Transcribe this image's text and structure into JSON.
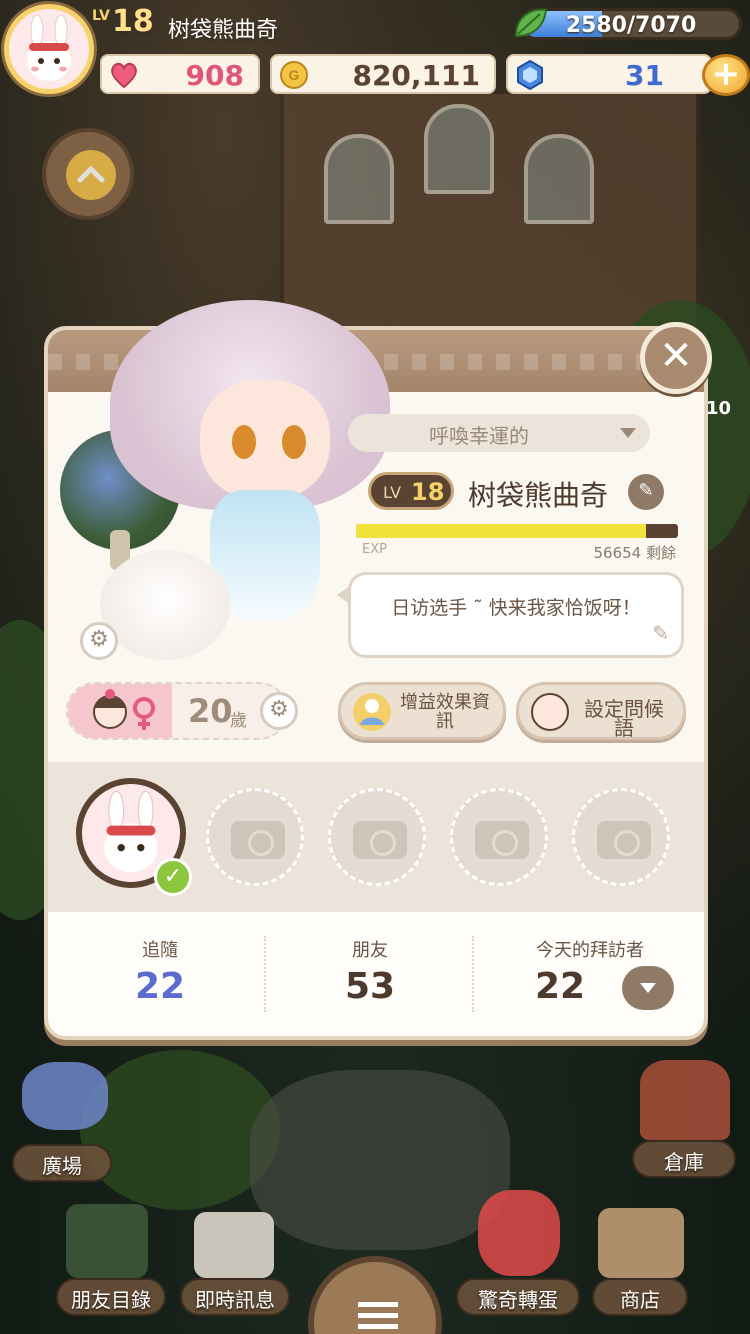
{
  "hud": {
    "level_label": "LV",
    "level": "18",
    "player_name": "树袋熊曲奇",
    "energy_text": "2580/7070",
    "energy_fraction": 0.365,
    "hearts": "908",
    "gold": "820,111",
    "gems": "31",
    "plus": "+"
  },
  "profile": {
    "close": "✕",
    "title_dropdown": "呼喚幸運的",
    "level_label": "LV",
    "level": "18",
    "name": "树袋熊曲奇",
    "exp_label": "EXP",
    "exp_remaining": "56654 剩餘",
    "exp_fraction": 0.9,
    "greeting": "日访选手 ˜ 快来我家恰饭呀！",
    "age_number": "20",
    "age_unit": "歲",
    "buff_button": "增益效果資訊",
    "greeting_button": "設定問候語",
    "stats": [
      {
        "label": "追隨",
        "value": "22",
        "color": "#5b6bd0"
      },
      {
        "label": "朋友",
        "value": "53",
        "color": "#4e3a2c"
      },
      {
        "label": "今天的拜訪者",
        "value": "22",
        "color": "#4e3a2c"
      }
    ]
  },
  "bottom_nav": {
    "plaza": "廣場",
    "warehouse": "倉庫",
    "friends_list": "朋友目錄",
    "messages": "即時訊息",
    "surprise_gacha": "驚奇轉蛋",
    "shop": "商店"
  },
  "side_badge": "10"
}
